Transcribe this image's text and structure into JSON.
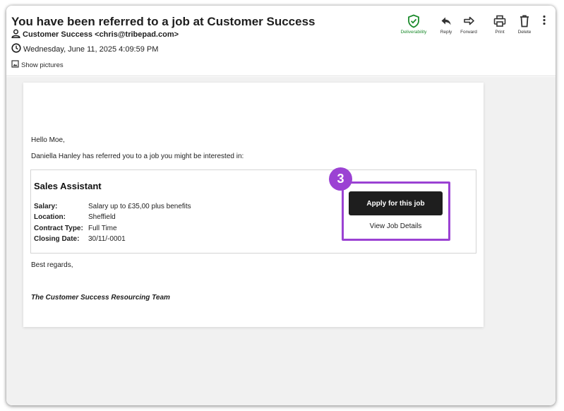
{
  "email": {
    "subject": "You have been referred to a job at Customer Success",
    "sender": "Customer Success <chris@tribepad.com>",
    "date": "Wednesday, June 11, 2025 4:09:59 PM",
    "show_pictures": "Show pictures"
  },
  "toolbar": {
    "deliverability": "Deliverability",
    "reply": "Reply",
    "forward": "Forward",
    "print": "Print",
    "delete": "Delete"
  },
  "message": {
    "greeting": "Hello Moe,",
    "intro": "Daniella Hanley has referred you to a job you might be interested in:",
    "job": {
      "title": "Sales Assistant",
      "details": [
        {
          "label": "Salary:",
          "value": "Salary up to £35,00 plus benefits"
        },
        {
          "label": "Location:",
          "value": "Sheffield"
        },
        {
          "label": "Contract Type:",
          "value": "Full Time"
        },
        {
          "label": "Closing Date:",
          "value": "30/11/-0001"
        }
      ],
      "apply_label": "Apply for this job",
      "view_label": "View Job Details"
    },
    "closing": "Best regards,",
    "signature": "The Customer Success Resourcing Team"
  },
  "annotation": {
    "step_number": "3",
    "color": "#9b42d3"
  },
  "colors": {
    "deliverability": "#1a8a2b",
    "button_dark": "#1e1e1e"
  },
  "icons": [
    "person-icon",
    "clock-icon",
    "image-icon",
    "shield-check-icon",
    "reply-icon",
    "forward-icon",
    "print-icon",
    "delete-icon",
    "more-vertical-icon"
  ]
}
